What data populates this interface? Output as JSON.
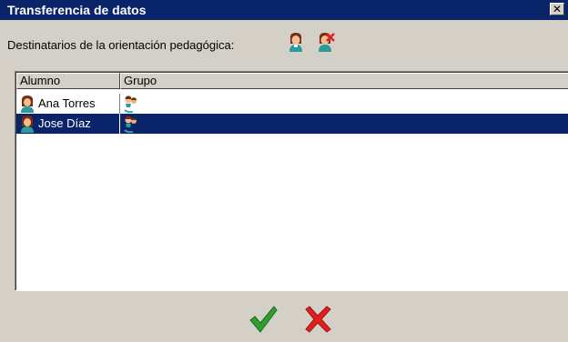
{
  "window": {
    "title": "Transferencia de datos",
    "close_glyph": "✕"
  },
  "recipients": {
    "label": "Destinatarios de la orientación pedagógica:",
    "icons": [
      "student-icon",
      "student-remove-icon"
    ]
  },
  "table": {
    "columns": [
      "Alumno",
      "Grupo"
    ],
    "rows": [
      {
        "name": "Ana Torres",
        "avatar_icon": "student-female-icon",
        "group_icon": "group-icon",
        "selected": false
      },
      {
        "name": "Jose Díaz",
        "avatar_icon": "student-female-icon",
        "group_icon": "group-icon",
        "selected": true
      }
    ]
  },
  "actions": {
    "ok_icon": "green-checkmark-icon",
    "cancel_icon": "red-x-icon"
  },
  "colors": {
    "titlebar": "#0a246a",
    "selection": "#0a246a",
    "face": "#d4d0c8",
    "ok": "#2e9e2e",
    "cancel": "#e02020"
  }
}
